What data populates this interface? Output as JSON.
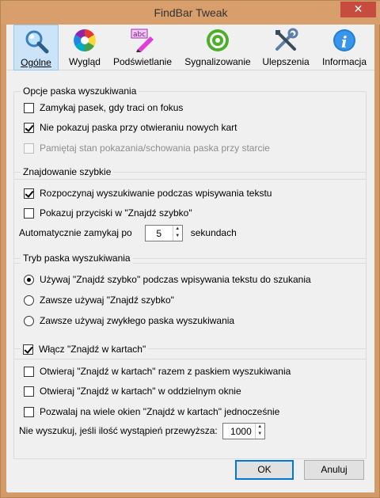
{
  "window": {
    "title": "FindBar Tweak",
    "close_glyph": "✕"
  },
  "tabs": [
    {
      "label": "Ogólne",
      "icon": "magnifier-icon",
      "active": true
    },
    {
      "label": "Wygląd",
      "icon": "color-wheel-icon"
    },
    {
      "label": "Podświetlanie",
      "icon": "highlighter-icon",
      "icon_text": "abc"
    },
    {
      "label": "Sygnalizowanie",
      "icon": "target-icon"
    },
    {
      "label": "Ulepszenia",
      "icon": "tools-icon"
    },
    {
      "label": "Informacja",
      "icon": "info-icon",
      "icon_text": "i"
    }
  ],
  "findbar_options": {
    "legend": "Opcje paska wyszukiwania",
    "close_on_blur": {
      "label": "Zamykaj pasek, gdy traci on fokus",
      "checked": false
    },
    "hide_on_new_tab": {
      "label": "Nie pokazuj paska przy otwieraniu nowych kart",
      "checked": true
    },
    "remember_state": {
      "label": "Pamiętaj stan pokazania/schowania paska przy starcie",
      "checked": false,
      "disabled": true
    }
  },
  "quickfind": {
    "legend": "Znajdowanie szybkie",
    "start_on_typing": {
      "label": "Rozpoczynaj wyszukiwanie podczas wpisywania tekstu",
      "checked": true
    },
    "show_buttons": {
      "label": "Pokazuj przyciski w \"Znajdź szybko\"",
      "checked": false
    },
    "autoclose_label": "Automatycznie zamykaj po",
    "autoclose_value": "5",
    "autoclose_unit": "sekundach"
  },
  "findbar_mode": {
    "legend": "Tryb paska wyszukiwania",
    "options": [
      {
        "label": "Używaj \"Znajdź szybko\" podczas wpisywania tekstu do szukania",
        "checked": true
      },
      {
        "label": "Zawsze używaj \"Znajdź szybko\"",
        "checked": false
      },
      {
        "label": "Zawsze używaj zwykłego paska wyszukiwania",
        "checked": false
      }
    ]
  },
  "find_in_tabs": {
    "legend": {
      "label": "Włącz \"Znajdź w kartach\"",
      "checked": true
    },
    "open_with_findbar": {
      "label": "Otwieraj \"Znajdź w kartach\" razem z paskiem wyszukiwania",
      "checked": false
    },
    "open_in_window": {
      "label": "Otwieraj \"Znajdź w kartach\" w oddzielnym oknie",
      "checked": false
    },
    "multiple_windows": {
      "label": "Pozwalaj na wiele okien \"Znajdź w kartach\" jednocześnie",
      "checked": false
    },
    "limit_label": "Nie wyszukuj, jeśli ilość wystąpień przewyższa:",
    "limit_value": "1000"
  },
  "buttons": {
    "ok": "OK",
    "cancel": "Anuluj"
  },
  "colors": {
    "accent": "#0078d7",
    "titlebar": "#d89e6b",
    "selected_tab": "#cce4f7"
  }
}
